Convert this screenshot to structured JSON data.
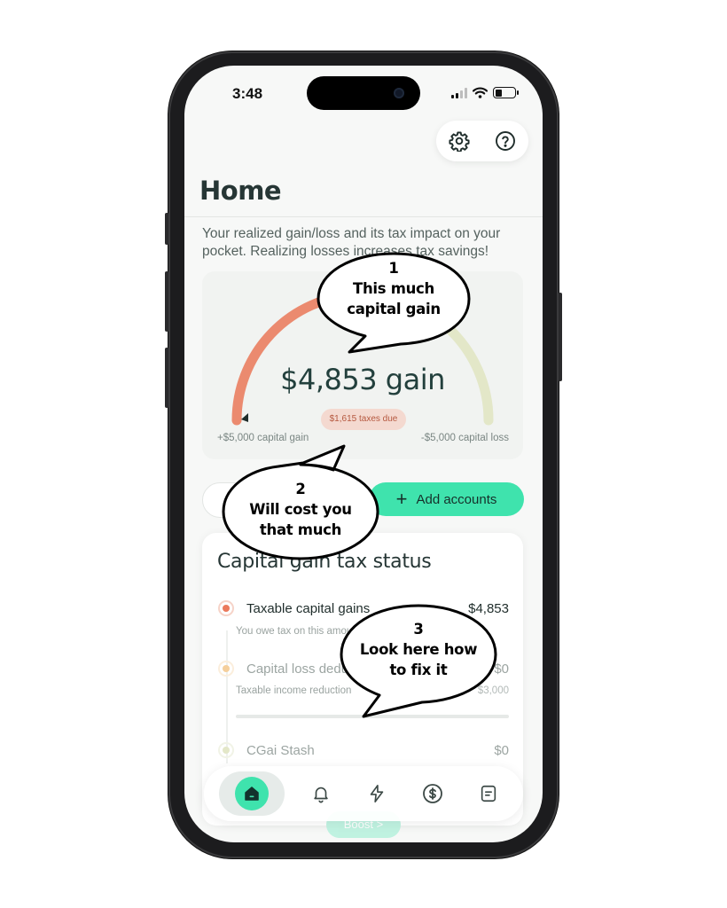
{
  "status_bar": {
    "time": "3:48"
  },
  "header": {
    "title": "Home",
    "settings_icon": "gear-icon",
    "help_icon": "question-circle-icon"
  },
  "intro_text": "Your realized gain/loss and its tax impact on your pocket. Realizing losses increases tax savings!",
  "gauge": {
    "value_text": "$4,853 gain",
    "tax_pill": "$1,615 taxes due",
    "left_label": "+$5,000 capital gain",
    "right_label": "-$5,000 capital loss",
    "gain_fraction": 0.485,
    "colors": {
      "gain": "#eb8a6f",
      "neutral": "#f4c9a5",
      "loss": "#e3e7c8"
    }
  },
  "actions": {
    "add_accounts_label": "Add accounts"
  },
  "tax_status": {
    "title": "Capital gain tax status",
    "rows": [
      {
        "label": "Taxable capital gains",
        "amount": "$4,853",
        "sub": "You owe tax on this amount",
        "dot_color": "#eb7a5c"
      },
      {
        "label": "Capital loss deductions",
        "amount": "$0",
        "sub": "Taxable income reduction",
        "sub_amount": "$3,000",
        "dot_color": "#f5cf9c"
      },
      {
        "label": "CGai Stash",
        "amount": "$0",
        "dot_color": "#e3e7c8"
      }
    ]
  },
  "boost": {
    "label": "Boost >"
  },
  "nav": {
    "items": [
      {
        "name": "home-icon",
        "active": true
      },
      {
        "name": "bell-icon",
        "active": false
      },
      {
        "name": "lightning-icon",
        "active": false
      },
      {
        "name": "dollar-circle-icon",
        "active": false
      },
      {
        "name": "document-icon",
        "active": false
      }
    ]
  },
  "callouts": [
    {
      "number": "1",
      "line1": "This much",
      "line2": "capital gain"
    },
    {
      "number": "2",
      "line1": "Will cost you",
      "line2": "that much"
    },
    {
      "number": "3",
      "line1": "Look here how",
      "line2": "to fix it"
    }
  ]
}
